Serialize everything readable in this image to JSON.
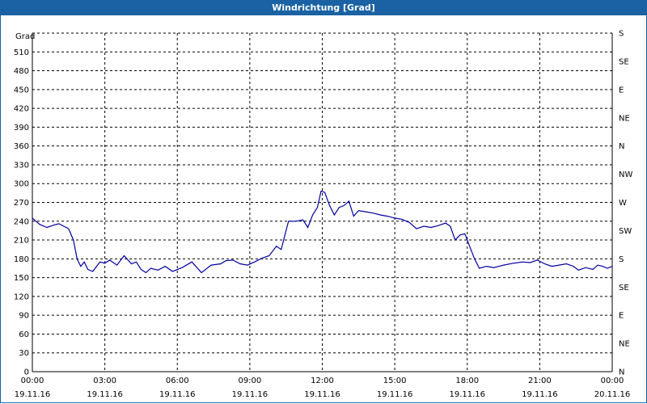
{
  "window": {
    "title": "Windrichtung [Grad]"
  },
  "chart_data": {
    "type": "line",
    "title": "Windrichtung [Grad]",
    "ylabel": "Grad",
    "ylim": [
      0,
      540
    ],
    "xlim_hours": [
      0,
      24
    ],
    "yticks": [
      0,
      30,
      60,
      90,
      120,
      150,
      180,
      210,
      240,
      270,
      300,
      330,
      360,
      390,
      420,
      450,
      480,
      510
    ],
    "right_axis_labels": [
      "N",
      "NE",
      "E",
      "SE",
      "S",
      "SW",
      "W",
      "NW",
      "N",
      "NE",
      "E",
      "SE",
      "S"
    ],
    "x_ticks": [
      {
        "time": "00:00",
        "date": "19.11.16"
      },
      {
        "time": "03:00",
        "date": "19.11.16"
      },
      {
        "time": "06:00",
        "date": "19.11.16"
      },
      {
        "time": "09:00",
        "date": "19.11.16"
      },
      {
        "time": "12:00",
        "date": "19.11.16"
      },
      {
        "time": "15:00",
        "date": "19.11.16"
      },
      {
        "time": "18:00",
        "date": "19.11.16"
      },
      {
        "time": "21:00",
        "date": "19.11.16"
      },
      {
        "time": "00:00",
        "date": "20.11.16"
      }
    ],
    "grid": true,
    "line_color": "#0000a0",
    "series": [
      {
        "name": "",
        "points": [
          [
            0.0,
            245
          ],
          [
            0.3,
            235
          ],
          [
            0.6,
            230
          ],
          [
            0.9,
            234
          ],
          [
            1.1,
            236
          ],
          [
            1.3,
            232
          ],
          [
            1.5,
            228
          ],
          [
            1.7,
            210
          ],
          [
            1.85,
            180
          ],
          [
            2.0,
            168
          ],
          [
            2.15,
            175
          ],
          [
            2.3,
            163
          ],
          [
            2.5,
            160
          ],
          [
            2.8,
            175
          ],
          [
            3.0,
            173
          ],
          [
            3.2,
            178
          ],
          [
            3.5,
            170
          ],
          [
            3.8,
            185
          ],
          [
            4.1,
            172
          ],
          [
            4.3,
            175
          ],
          [
            4.5,
            163
          ],
          [
            4.7,
            158
          ],
          [
            4.9,
            165
          ],
          [
            5.2,
            162
          ],
          [
            5.5,
            168
          ],
          [
            5.8,
            160
          ],
          [
            6.2,
            166
          ],
          [
            6.6,
            175
          ],
          [
            7.0,
            158
          ],
          [
            7.4,
            170
          ],
          [
            7.8,
            172
          ],
          [
            8.0,
            177
          ],
          [
            8.3,
            178
          ],
          [
            8.6,
            172
          ],
          [
            8.9,
            170
          ],
          [
            9.2,
            175
          ],
          [
            9.5,
            181
          ],
          [
            9.8,
            185
          ],
          [
            10.1,
            200
          ],
          [
            10.3,
            195
          ],
          [
            10.6,
            240
          ],
          [
            10.9,
            240
          ],
          [
            11.2,
            242
          ],
          [
            11.4,
            230
          ],
          [
            11.6,
            250
          ],
          [
            11.8,
            262
          ],
          [
            11.95,
            288
          ],
          [
            12.1,
            286
          ],
          [
            12.3,
            265
          ],
          [
            12.5,
            250
          ],
          [
            12.7,
            262
          ],
          [
            12.9,
            265
          ],
          [
            13.1,
            272
          ],
          [
            13.3,
            248
          ],
          [
            13.5,
            257
          ],
          [
            13.8,
            255
          ],
          [
            14.1,
            253
          ],
          [
            14.4,
            250
          ],
          [
            14.7,
            248
          ],
          [
            15.0,
            245
          ],
          [
            15.3,
            243
          ],
          [
            15.6,
            238
          ],
          [
            15.9,
            228
          ],
          [
            16.2,
            232
          ],
          [
            16.5,
            230
          ],
          [
            16.8,
            233
          ],
          [
            17.1,
            237
          ],
          [
            17.3,
            232
          ],
          [
            17.5,
            210
          ],
          [
            17.7,
            218
          ],
          [
            17.9,
            220
          ],
          [
            18.1,
            200
          ],
          [
            18.3,
            180
          ],
          [
            18.5,
            165
          ],
          [
            18.8,
            168
          ],
          [
            19.1,
            166
          ],
          [
            19.5,
            170
          ],
          [
            19.9,
            173
          ],
          [
            20.3,
            175
          ],
          [
            20.6,
            174
          ],
          [
            20.9,
            178
          ],
          [
            21.2,
            172
          ],
          [
            21.5,
            168
          ],
          [
            21.8,
            170
          ],
          [
            22.1,
            172
          ],
          [
            22.4,
            168
          ],
          [
            22.6,
            162
          ],
          [
            22.9,
            166
          ],
          [
            23.2,
            163
          ],
          [
            23.4,
            170
          ],
          [
            23.6,
            168
          ],
          [
            23.8,
            165
          ],
          [
            24.0,
            168
          ]
        ]
      }
    ]
  }
}
